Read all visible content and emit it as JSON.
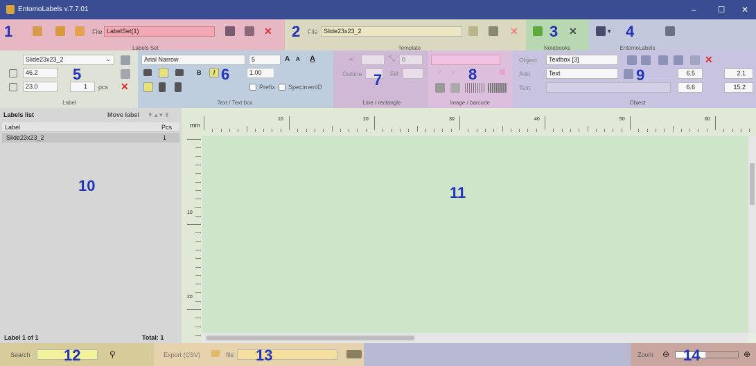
{
  "window": {
    "title": "EntomoLabels v.7.7.01",
    "min": "–",
    "max": "☐",
    "close": "✕"
  },
  "sections": {
    "labels_set": {
      "caption": "Labels Set",
      "file_label": "File",
      "file_value": "LabelSet(1)",
      "number": "1"
    },
    "template": {
      "caption": "Template",
      "file_label": "File",
      "file_value": "Slide23x23_2",
      "number": "2"
    },
    "notebooks": {
      "caption": "Notebooks",
      "number": "3"
    },
    "entomolabels": {
      "caption": "EntomoLabels",
      "number": "4"
    },
    "label": {
      "caption": "Label",
      "template": "Slide23x23_2",
      "width": "46.2",
      "height": "23.0",
      "pcs_value": "1",
      "pcs_label": "pcs",
      "number": "5"
    },
    "text": {
      "caption": "Text / Text box",
      "font": "Arial Narrow",
      "size": "5",
      "line_spacing": "1.00",
      "bold": "B",
      "italic": "I",
      "prefix": "Prefix",
      "specimen": "SpecimenID",
      "number": "6"
    },
    "line": {
      "caption": "Line / rectangle",
      "outline": "Outline",
      "fill": "Fill",
      "value": "0",
      "number": "7"
    },
    "image": {
      "caption": "Image / barcode",
      "number": "8"
    },
    "object": {
      "caption": "Object",
      "object_label": "Object",
      "object_value": "Textbox [3]",
      "add_label": "Add",
      "add_value": "Text",
      "text_label": "Text",
      "v1": "6.5",
      "v2": "2.1",
      "v3": "6.6",
      "v4": "15.2",
      "number": "9"
    }
  },
  "labels_list": {
    "title": "Labels list",
    "move_label": "Move label",
    "col_label": "Label",
    "col_pcs": "Pcs",
    "rows": [
      {
        "label": "Slide23x23_2",
        "pcs": "1"
      }
    ],
    "footer_left": "Label 1 of 1",
    "footer_right": "Total: 1",
    "number": "10"
  },
  "canvas": {
    "unit": "mm",
    "ruler_top": [
      "10",
      "20",
      "30",
      "40",
      "50",
      "60"
    ],
    "ruler_left": [
      "10",
      "20"
    ],
    "number": "11"
  },
  "bottom": {
    "search_label": "Search",
    "search_number": "12",
    "export_label": "Export (CSV)",
    "export_file": "file",
    "export_number": "13",
    "zoom_label": "Zoom",
    "zoom_number": "14"
  },
  "colors": {
    "labels_set": "#e7b7c3",
    "template": "#dad8be",
    "notebooks": "#b7d8b0",
    "entomolabels": "#c4c8dc",
    "label": "#dfe2d6",
    "text": "#bfcedf",
    "line": "#cfb9d6",
    "image": "#dcbfdc",
    "object": "#c8c3e0",
    "canvas": "#cfe5c9",
    "list": "#d6d6d6"
  }
}
